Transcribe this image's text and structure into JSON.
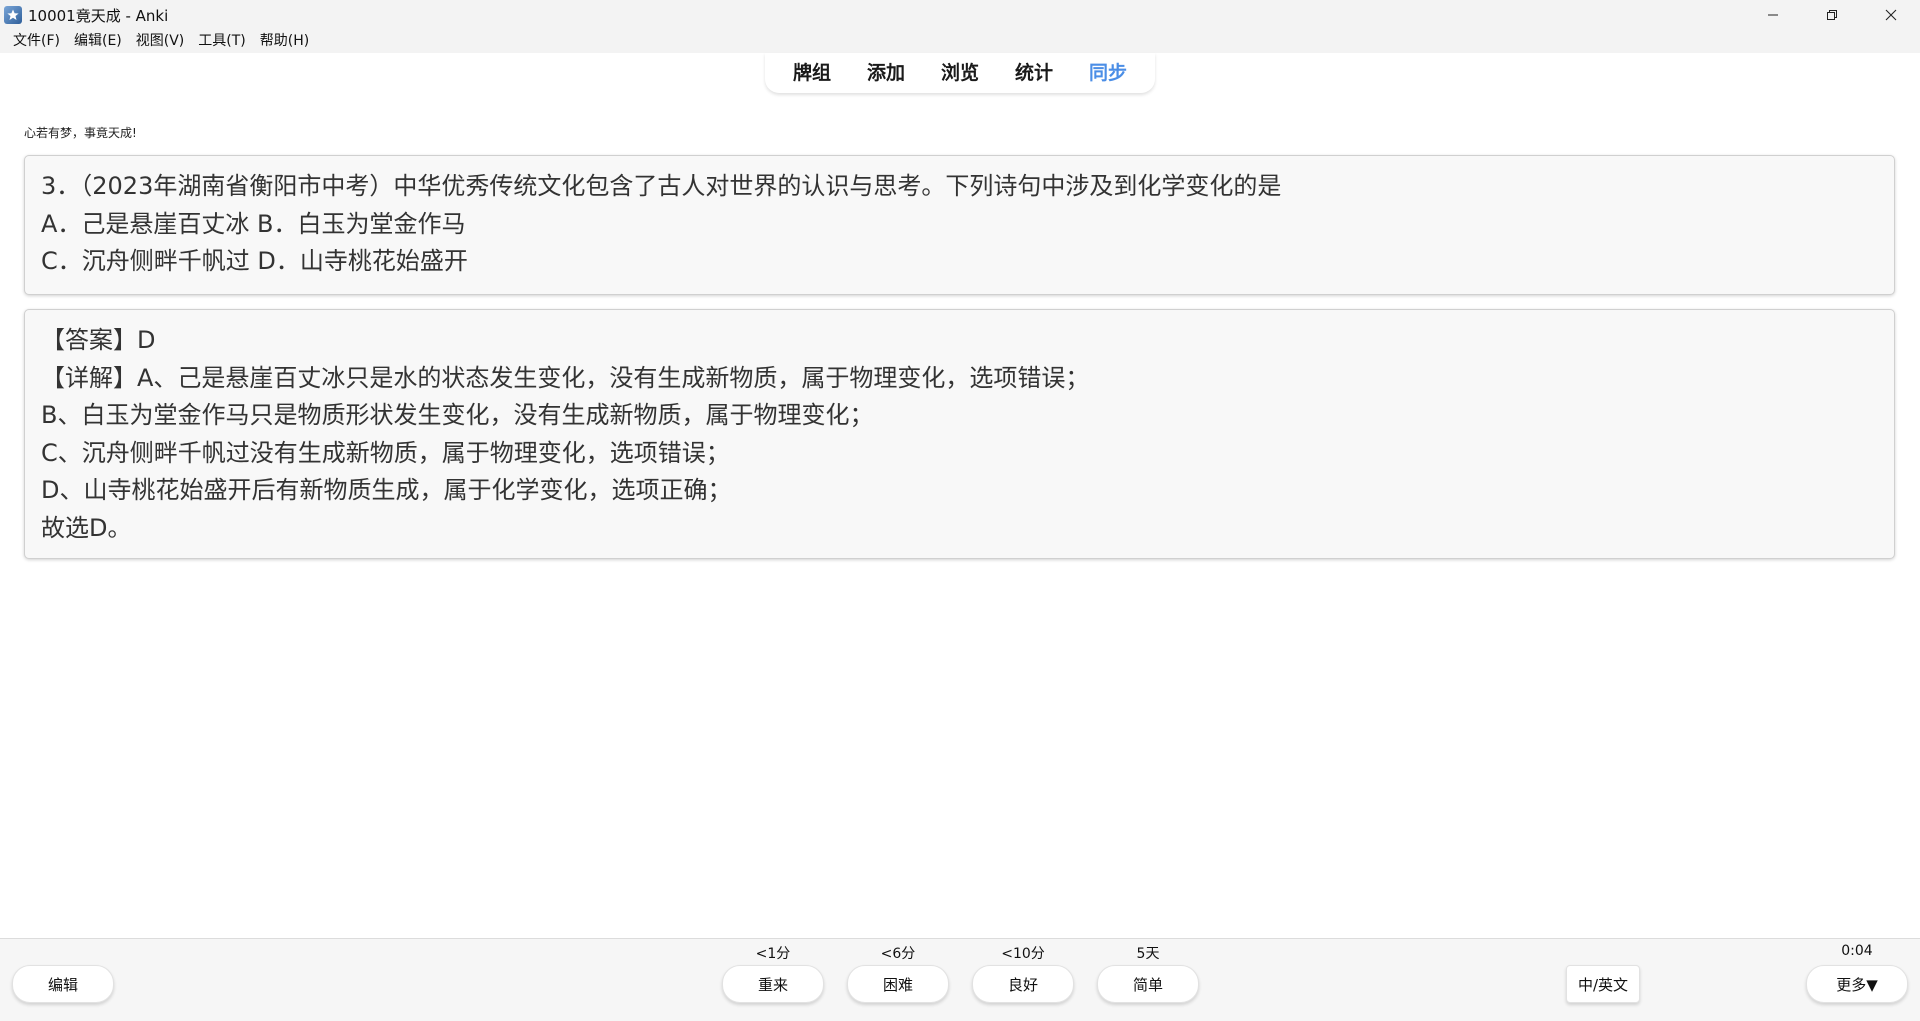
{
  "window": {
    "title": "10001竟天成 - Anki",
    "icon": "anki-app-icon",
    "controls": [
      "minimize-icon",
      "restore-icon",
      "close-icon"
    ]
  },
  "menu": [
    {
      "label": "文件(F)"
    },
    {
      "label": "编辑(E)"
    },
    {
      "label": "视图(V)"
    },
    {
      "label": "工具(T)"
    },
    {
      "label": "帮助(H)"
    }
  ],
  "toolbar": {
    "items": [
      {
        "label": "牌组"
      },
      {
        "label": "添加"
      },
      {
        "label": "浏览"
      },
      {
        "label": "统计"
      },
      {
        "label": "同步"
      }
    ],
    "active_color": "#4b8ee6"
  },
  "card": {
    "motto": "心若有梦，事竟天成!",
    "question_lines": [
      "3．（2023年湖南省衡阳市中考）中华优秀传统文化包含了古人对世界的认识与思考。下列诗句中涉及到化学变化的是",
      "A．己是悬崖百丈冰 B．白玉为堂金作马",
      "C．沉舟侧畔千帆过 D．山寺桃花始盛开"
    ],
    "answer_lines": [
      "【答案】D",
      "【详解】A、己是悬崖百丈冰只是水的状态发生变化，没有生成新物质，属于物理变化，选项错误；",
      "B、白玉为堂金作马只是物质形状发生变化，没有生成新物质，属于物理变化；",
      "C、沉舟侧畔千帆过没有生成新物质，属于物理变化，选项错误；",
      "D、山寺桃花始盛开后有新物质生成，属于化学变化，选项正确；",
      "故选D。"
    ]
  },
  "bottom": {
    "edit_label": "编辑",
    "answers": [
      {
        "interval": "<1分",
        "label": "重来"
      },
      {
        "interval": "<6分",
        "label": "困难"
      },
      {
        "interval": "<10分",
        "label": "良好"
      },
      {
        "interval": "5天",
        "label": "简单"
      }
    ],
    "lang_label": "中/英文",
    "timer": "0:04",
    "more_label": "更多▼"
  }
}
